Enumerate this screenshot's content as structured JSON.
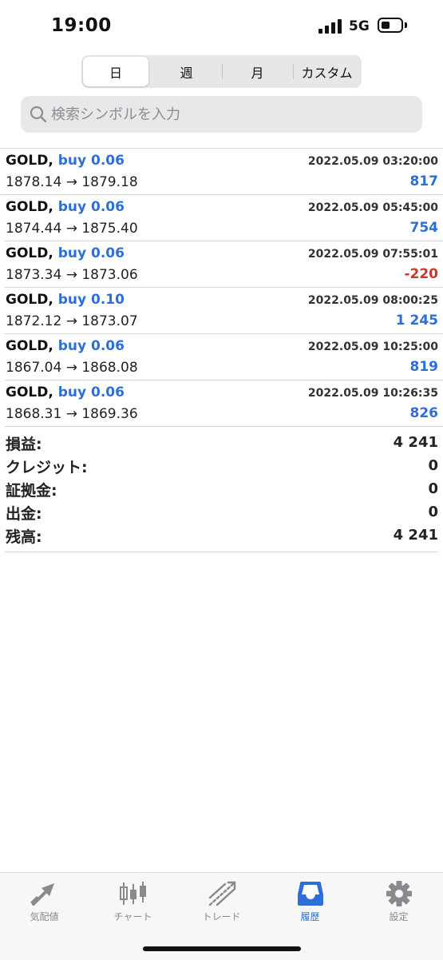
{
  "status": {
    "time": "19:00",
    "network": "5G"
  },
  "segments": [
    {
      "label": "日",
      "active": true
    },
    {
      "label": "週",
      "active": false
    },
    {
      "label": "月",
      "active": false
    },
    {
      "label": "カスタム",
      "active": false
    }
  ],
  "search": {
    "placeholder": "検索シンボルを入力",
    "icon": "search-icon"
  },
  "trades": [
    {
      "symbol": "GOLD,",
      "direction": "buy 0.06",
      "datetime": "2022.05.09 03:20:00",
      "prices": "1878.14 → 1879.18",
      "profit": "817",
      "profit_sign": "pos"
    },
    {
      "symbol": "GOLD,",
      "direction": "buy 0.06",
      "datetime": "2022.05.09 05:45:00",
      "prices": "1874.44 → 1875.40",
      "profit": "754",
      "profit_sign": "pos"
    },
    {
      "symbol": "GOLD,",
      "direction": "buy 0.06",
      "datetime": "2022.05.09 07:55:01",
      "prices": "1873.34 → 1873.06",
      "profit": "-220",
      "profit_sign": "neg"
    },
    {
      "symbol": "GOLD,",
      "direction": "buy 0.10",
      "datetime": "2022.05.09 08:00:25",
      "prices": "1872.12 → 1873.07",
      "profit": "1 245",
      "profit_sign": "pos"
    },
    {
      "symbol": "GOLD,",
      "direction": "buy 0.06",
      "datetime": "2022.05.09 10:25:00",
      "prices": "1867.04 → 1868.08",
      "profit": "819",
      "profit_sign": "pos"
    },
    {
      "symbol": "GOLD,",
      "direction": "buy 0.06",
      "datetime": "2022.05.09 10:26:35",
      "prices": "1868.31 → 1869.36",
      "profit": "826",
      "profit_sign": "pos"
    }
  ],
  "summary": [
    {
      "label": "損益:",
      "value": "4 241"
    },
    {
      "label": "クレジット:",
      "value": "0"
    },
    {
      "label": "証拠金:",
      "value": "0"
    },
    {
      "label": "出金:",
      "value": "0"
    },
    {
      "label": "残高:",
      "value": "4 241"
    }
  ],
  "tabs": [
    {
      "label": "気配値",
      "icon": "quotes-icon",
      "active": false
    },
    {
      "label": "チャート",
      "icon": "candlestick-chart-icon",
      "active": false
    },
    {
      "label": "トレード",
      "icon": "trade-icon",
      "active": false
    },
    {
      "label": "履歴",
      "icon": "history-inbox-icon",
      "active": true
    },
    {
      "label": "設定",
      "icon": "gear-icon",
      "active": false
    }
  ],
  "colors": {
    "accent": "#2d6fd8",
    "negative": "#c8372a",
    "inactive_tab": "#8a8a8e"
  }
}
